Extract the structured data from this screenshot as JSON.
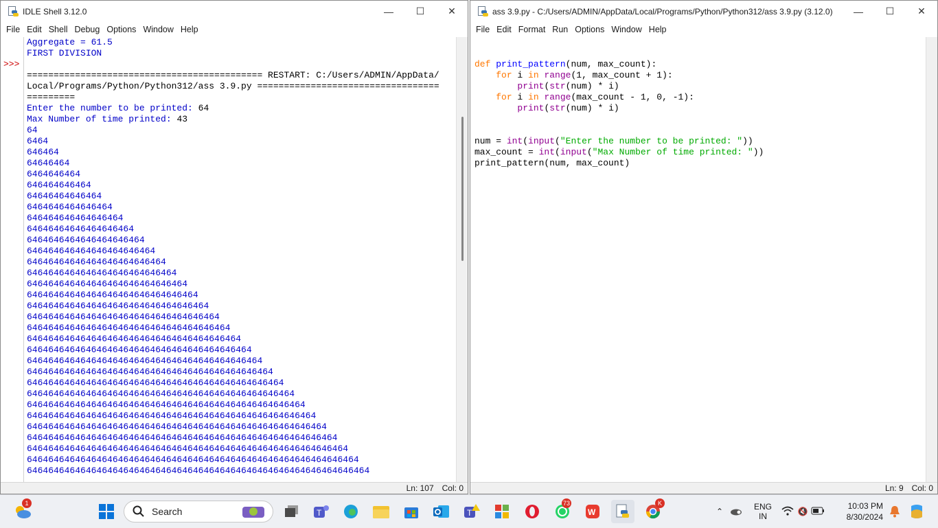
{
  "shell": {
    "title": "IDLE Shell 3.12.0",
    "menu": [
      "File",
      "Edit",
      "Shell",
      "Debug",
      "Options",
      "Window",
      "Help"
    ],
    "prompt": ">>>",
    "lines": [
      {
        "t": "Aggregate = 61.5",
        "c": "out"
      },
      {
        "t": "FIRST DIVISION",
        "c": "out"
      },
      {
        "t": "",
        "c": "std"
      },
      {
        "t": "============================================ RESTART: C:/Users/ADMIN/AppData/",
        "c": "std"
      },
      {
        "t": "Local/Programs/Python/Python312/ass 3.9.py ==================================",
        "c": "std"
      },
      {
        "t": "=========",
        "c": "std"
      },
      {
        "t": "Enter the number to be printed: 64",
        "c": "mix1"
      },
      {
        "t": "Max Number of time printed: 43",
        "c": "mix2"
      },
      {
        "t": "64",
        "c": "out"
      },
      {
        "t": "6464",
        "c": "out"
      },
      {
        "t": "646464",
        "c": "out"
      },
      {
        "t": "64646464",
        "c": "out"
      },
      {
        "t": "6464646464",
        "c": "out"
      },
      {
        "t": "646464646464",
        "c": "out"
      },
      {
        "t": "64646464646464",
        "c": "out"
      },
      {
        "t": "6464646464646464",
        "c": "out"
      },
      {
        "t": "646464646464646464",
        "c": "out"
      },
      {
        "t": "64646464646464646464",
        "c": "out"
      },
      {
        "t": "6464646464646464646464",
        "c": "out"
      },
      {
        "t": "646464646464646464646464",
        "c": "out"
      },
      {
        "t": "64646464646464646464646464",
        "c": "out"
      },
      {
        "t": "6464646464646464646464646464",
        "c": "out"
      },
      {
        "t": "646464646464646464646464646464",
        "c": "out"
      },
      {
        "t": "64646464646464646464646464646464",
        "c": "out"
      },
      {
        "t": "6464646464646464646464646464646464",
        "c": "out"
      },
      {
        "t": "646464646464646464646464646464646464",
        "c": "out"
      },
      {
        "t": "64646464646464646464646464646464646464",
        "c": "out"
      },
      {
        "t": "6464646464646464646464646464646464646464",
        "c": "out"
      },
      {
        "t": "646464646464646464646464646464646464646464",
        "c": "out"
      },
      {
        "t": "64646464646464646464646464646464646464646464",
        "c": "out"
      },
      {
        "t": "6464646464646464646464646464646464646464646464",
        "c": "out"
      },
      {
        "t": "646464646464646464646464646464646464646464646464",
        "c": "out"
      },
      {
        "t": "64646464646464646464646464646464646464646464646464",
        "c": "out"
      },
      {
        "t": "6464646464646464646464646464646464646464646464646464",
        "c": "out"
      },
      {
        "t": "646464646464646464646464646464646464646464646464646464",
        "c": "out"
      },
      {
        "t": "64646464646464646464646464646464646464646464646464646464",
        "c": "out"
      },
      {
        "t": "6464646464646464646464646464646464646464646464646464646464",
        "c": "out"
      },
      {
        "t": "646464646464646464646464646464646464646464646464646464646464",
        "c": "out"
      },
      {
        "t": "64646464646464646464646464646464646464646464646464646464646464",
        "c": "out"
      },
      {
        "t": "6464646464646464646464646464646464646464646464646464646464646464",
        "c": "out"
      }
    ],
    "status_ln": "Ln: 107",
    "status_col": "Col: 0"
  },
  "editor": {
    "title": "ass 3.9.py - C:/Users/ADMIN/AppData/Local/Programs/Python/Python312/ass 3.9.py (3.12.0)",
    "menu": [
      "File",
      "Edit",
      "Format",
      "Run",
      "Options",
      "Window",
      "Help"
    ],
    "code": [
      [
        [
          "def",
          "kw"
        ],
        [
          " ",
          ""
        ],
        [
          "print_pattern",
          "def"
        ],
        [
          "(num, max_count):",
          ""
        ]
      ],
      [
        [
          "    ",
          ""
        ],
        [
          "for",
          "kw"
        ],
        [
          " i ",
          ""
        ],
        [
          "in",
          "kw"
        ],
        [
          " ",
          ""
        ],
        [
          "range",
          "bi"
        ],
        [
          "(1, max_count + 1):",
          ""
        ]
      ],
      [
        [
          "        ",
          ""
        ],
        [
          "print",
          "bi"
        ],
        [
          "(",
          ""
        ],
        [
          "str",
          "bi"
        ],
        [
          "(num) * i)",
          ""
        ]
      ],
      [
        [
          "    ",
          ""
        ],
        [
          "for",
          "kw"
        ],
        [
          " i ",
          ""
        ],
        [
          "in",
          "kw"
        ],
        [
          " ",
          ""
        ],
        [
          "range",
          "bi"
        ],
        [
          "(max_count - 1, 0, -1):",
          ""
        ]
      ],
      [
        [
          "        ",
          ""
        ],
        [
          "print",
          "bi"
        ],
        [
          "(",
          ""
        ],
        [
          "str",
          "bi"
        ],
        [
          "(num) * i)",
          ""
        ]
      ],
      [
        [
          "",
          ""
        ]
      ],
      [
        [
          "",
          ""
        ]
      ],
      [
        [
          "num = ",
          ""
        ],
        [
          "int",
          "bi"
        ],
        [
          "(",
          ""
        ],
        [
          "input",
          "bi"
        ],
        [
          "(",
          ""
        ],
        [
          "\"Enter the number to be printed: \"",
          "str"
        ],
        [
          "))",
          ""
        ]
      ],
      [
        [
          "max_count = ",
          ""
        ],
        [
          "int",
          "bi"
        ],
        [
          "(",
          ""
        ],
        [
          "input",
          "bi"
        ],
        [
          "(",
          ""
        ],
        [
          "\"Max Number of time printed: \"",
          "str"
        ],
        [
          "))",
          ""
        ]
      ],
      [
        [
          "print_pattern(num, max_count)",
          ""
        ]
      ]
    ],
    "status_ln": "Ln: 9",
    "status_col": "Col: 0"
  },
  "taskbar": {
    "search_label": "Search",
    "lang_top": "ENG",
    "lang_bottom": "IN",
    "time": "10:03 PM",
    "date": "8/30/2024",
    "whatsapp_badge": "73",
    "weather_badge": "1",
    "chrome_badge": "K"
  }
}
